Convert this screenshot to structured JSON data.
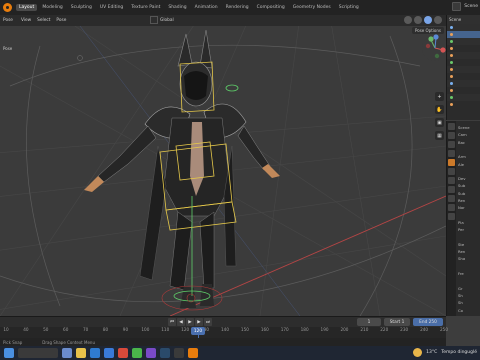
{
  "topbar": {
    "workspaces": [
      "Layout",
      "Modeling",
      "Sculpting",
      "UV Editing",
      "Texture Paint",
      "Shading",
      "Animation",
      "Rendering",
      "Compositing",
      "Geometry Nodes",
      "Scripting"
    ],
    "active_index": 0,
    "scene_label": "Scene"
  },
  "viewport": {
    "mode_label": "Pose",
    "orientation_label": "Global",
    "pose_options_label": "Pose Options"
  },
  "timeline": {
    "current_frame": "120",
    "start_label": "Start",
    "start_value": "1",
    "end_label": "End",
    "end_value": "250",
    "field_left": "1",
    "ticks": [
      "10",
      "40",
      "50",
      "60",
      "70",
      "80",
      "90",
      "100",
      "110",
      "120",
      "130",
      "140",
      "150",
      "160",
      "170",
      "180",
      "190",
      "200",
      "210",
      "220",
      "230",
      "240",
      "250"
    ]
  },
  "statusbar": {
    "left": "Pick Snap",
    "center": "Drag Shape Context Menu"
  },
  "outliner": {
    "header": "Scene"
  },
  "properties": {
    "rows": [
      "Scene",
      "Cam",
      "Bac",
      "",
      "Arm",
      "Ale",
      "",
      "Dev",
      "Sub",
      "Sub",
      "Ren",
      "Nor",
      "",
      "Pla",
      "Per",
      "",
      "Ste",
      "Ren",
      "Sha",
      "",
      "Fre",
      "",
      "Gr",
      "Sh",
      "Sh",
      "Co"
    ]
  },
  "taskbar": {
    "weather": "13°C",
    "weather_text": "Tempo dinguglé"
  },
  "colors": {
    "blender_orange": "#e87d0d",
    "selection_blue": "#4a70b0",
    "bone_outline": "#e5c84a"
  }
}
